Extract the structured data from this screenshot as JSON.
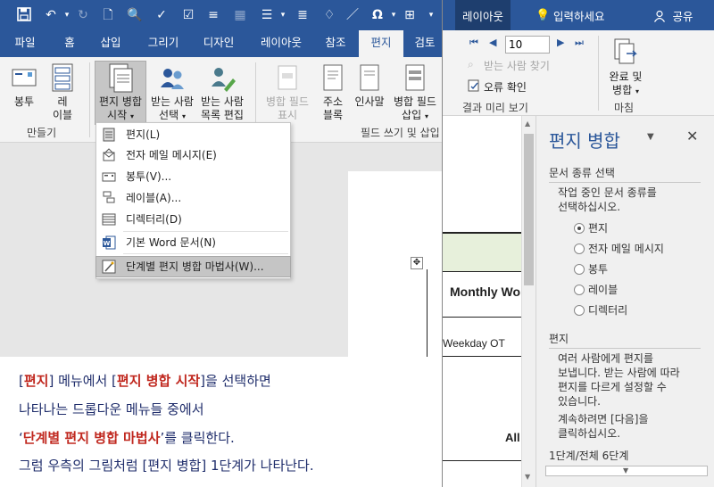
{
  "left_window": {
    "tabs": [
      "파일",
      "홈",
      "삽입",
      "그리기",
      "디자인",
      "레이아웃",
      "참조",
      "편지",
      "검토"
    ],
    "active_tab": "편지",
    "ribbon": {
      "envelope": "봉투",
      "label": [
        "레",
        "이블"
      ],
      "start_merge": [
        "편지 병합",
        "시작"
      ],
      "select_recipients": [
        "받는 사람",
        "선택"
      ],
      "edit_recipients": [
        "받는 사람",
        "목록 편집"
      ],
      "highlight_fields": [
        "병합 필드",
        "표시"
      ],
      "address_block": [
        "주소",
        "블록"
      ],
      "greeting_line": "인사말",
      "insert_merge_field": [
        "병합 필드",
        "삽입"
      ],
      "group_create": "만들기",
      "group_write": "필드 쓰기 및 삽입"
    },
    "dropdown": {
      "items": [
        "편지(L)",
        "전자 메일 메시지(E)",
        "봉투(V)...",
        "레이블(A)...",
        "디렉터리(D)",
        "기본 Word 문서(N)",
        "단계별 편지 병합 마법사(W)..."
      ],
      "highlighted_index": 6
    },
    "caption": {
      "line1": [
        "[",
        "편지",
        "] 메뉴에서 [",
        "편지 병합 시작",
        "]을 선택하면"
      ],
      "line2": "나타나는 드롭다운 메뉴들 중에서",
      "line3": [
        "‘",
        "단계별 편지 병합 마법사",
        "’를 클릭한다."
      ],
      "line4": "그럼 우측의 그림처럼 [편지 병합] 1단계가 나타난다."
    }
  },
  "right_window": {
    "tabs": {
      "layout": "레이아웃",
      "tell_me": "입력하세요",
      "share": "공유"
    },
    "ribbon": {
      "record_value": "10",
      "find_recipient": "받는 사람 찾기",
      "check_errors": "오류 확인",
      "group_preview": "결과 미리 보기",
      "finish_merge": [
        "완료 및",
        "병합"
      ],
      "group_finish": "마침"
    },
    "doc": {
      "header": "Monthly Wo",
      "row": "Weekday OT",
      "all": "All"
    },
    "pane": {
      "title": "편지 병합",
      "section_doc_type": "문서 종류 선택",
      "doc_type_prompt": [
        "작업 중인 문서 종류를",
        "선택하십시오."
      ],
      "options": [
        "편지",
        "전자 메일 메시지",
        "봉투",
        "레이블",
        "디렉터리"
      ],
      "selected_option": 0,
      "section_letter": "편지",
      "letter_desc": [
        "여러 사람에게 편지를",
        "보냅니다. 받는 사람에 따라",
        "편지를 다르게 설정할 수",
        "있습니다."
      ],
      "continue_desc": [
        "계속하려면 [다음]을",
        "클릭하십시오."
      ],
      "step": "1단계/전체 6단계"
    }
  },
  "colors": {
    "office_blue": "#2b579a",
    "caption_red": "#c0281f",
    "caption_navy": "#1f2d6b"
  }
}
